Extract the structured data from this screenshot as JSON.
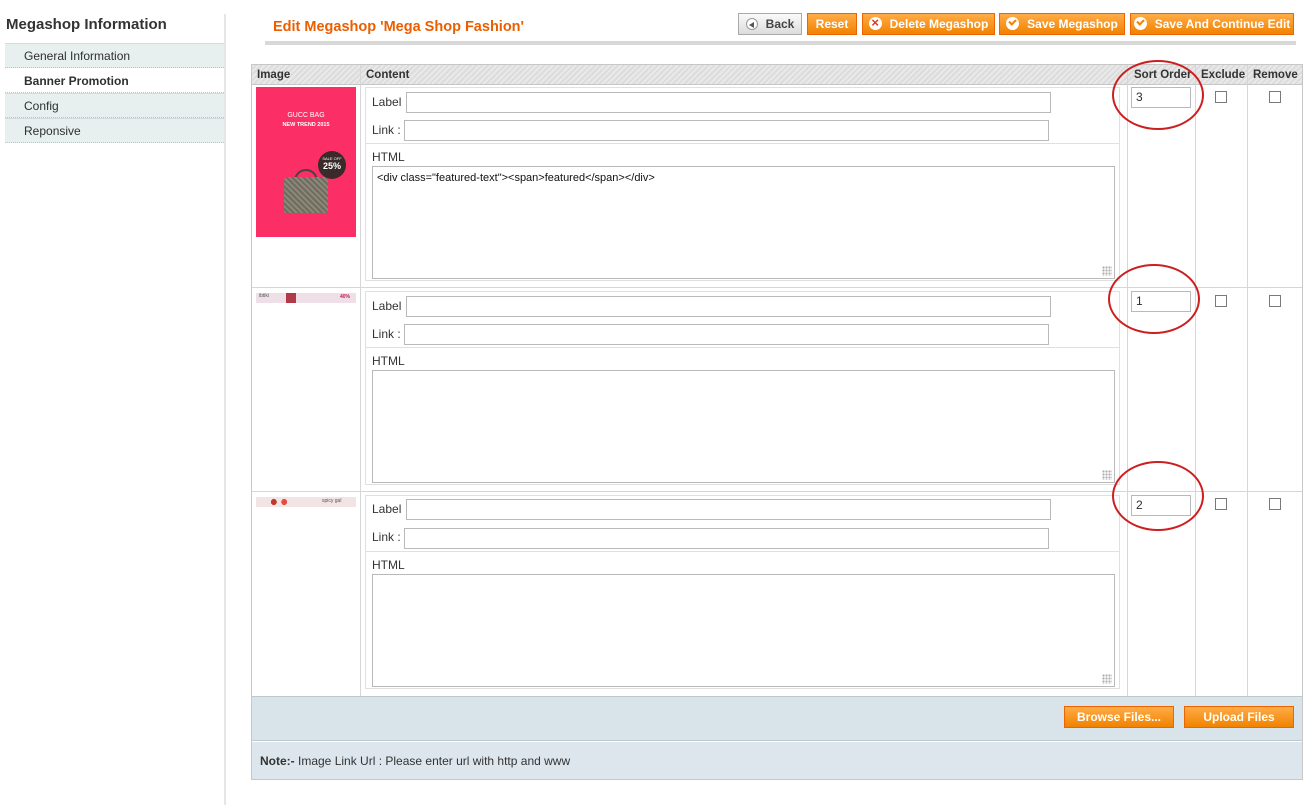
{
  "sidebar": {
    "title": "Megashop Information",
    "tabs": [
      {
        "label": "General Information"
      },
      {
        "label": "Banner Promotion"
      },
      {
        "label": "Config"
      },
      {
        "label": "Reponsive"
      }
    ]
  },
  "header": {
    "title": "Edit Megashop 'Mega Shop Fashion'",
    "buttons": {
      "back": "Back",
      "reset": "Reset",
      "delete": "Delete Megashop",
      "save": "Save Megashop",
      "save_continue": "Save And Continue Edit"
    }
  },
  "grid": {
    "columns": {
      "image": "Image",
      "content": "Content",
      "sort_order": "Sort Order",
      "exclude": "Exclude",
      "remove": "Remove"
    },
    "field_labels": {
      "label": "Label",
      "link": "Link :",
      "html": "HTML"
    },
    "rows": [
      {
        "thumb_text_1": "GUCC BAG",
        "thumb_text_2": "NEW TREND 2015",
        "badge_small": "SALE OFF",
        "badge_big": "25%",
        "label_value": "",
        "link_value": "",
        "html_value": "<div class=\"featured-text\"><span>featured</span></div>",
        "sort_order": "3",
        "exclude": false,
        "remove": false
      },
      {
        "thumb_text_1": "ibtiki",
        "thumb_text_2": "40%",
        "label_value": "",
        "link_value": "",
        "html_value": "",
        "sort_order": "1",
        "exclude": false,
        "remove": false
      },
      {
        "thumb_text_1": "spicy gal",
        "label_value": "",
        "link_value": "",
        "html_value": "",
        "sort_order": "2",
        "exclude": false,
        "remove": false
      }
    ]
  },
  "upload": {
    "browse": "Browse Files...",
    "upload": "Upload Files"
  },
  "note": {
    "prefix": "Note:-",
    "text": " Image Link Url : Please enter url with http and www"
  },
  "colors": {
    "accent_orange": "#eb5e00",
    "button_orange": "#f18200",
    "annotation_red": "#cc1f1f",
    "panel_blue": "#d9e3ea"
  }
}
